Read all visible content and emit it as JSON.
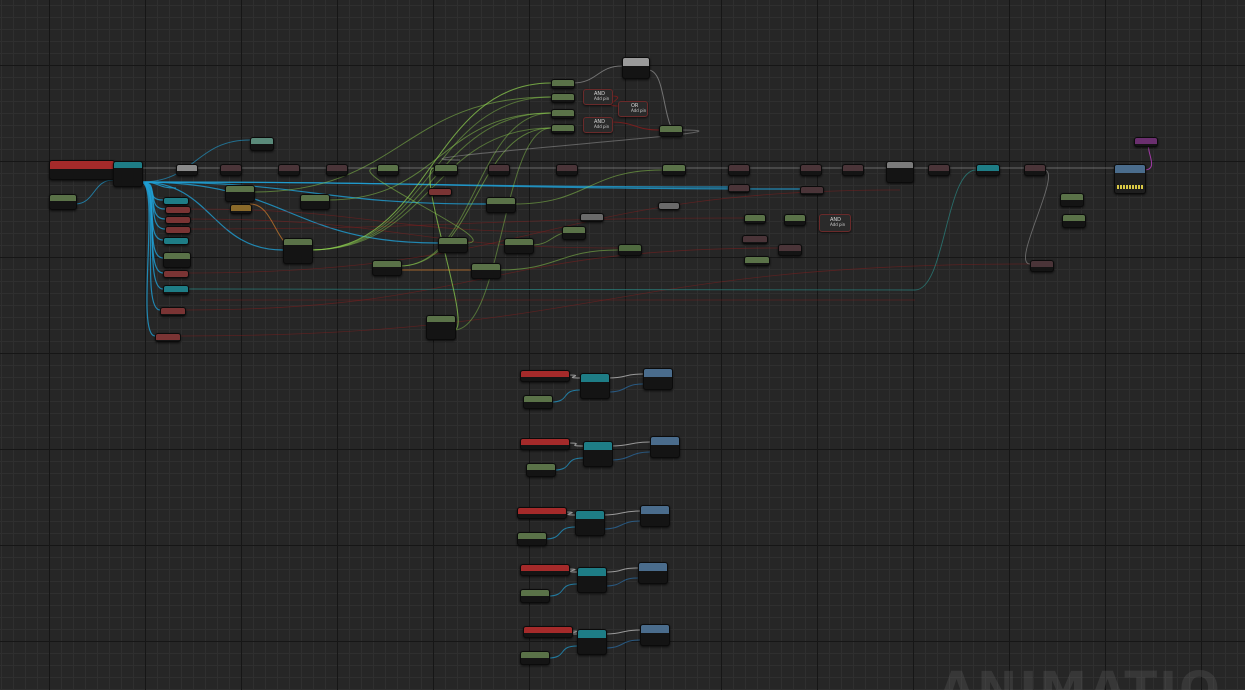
{
  "graph": {
    "watermark": "ANIMATIO",
    "and_label": "AND",
    "or_label": "OR",
    "and_sub": "Add pin",
    "event_title": "",
    "colors": {
      "background": "#262626",
      "exec_wire": "#e6e6e6",
      "bool_wire": "#8c1c1c",
      "float_wire": "#8fd14f",
      "object_wire": "#1fa0d6",
      "struct_wire": "#2a6ea6",
      "int_wire": "#f08c2c",
      "purple_pin": "#c03ec6"
    },
    "icons": [
      "exec-pin-icon",
      "data-pin-icon"
    ]
  }
}
